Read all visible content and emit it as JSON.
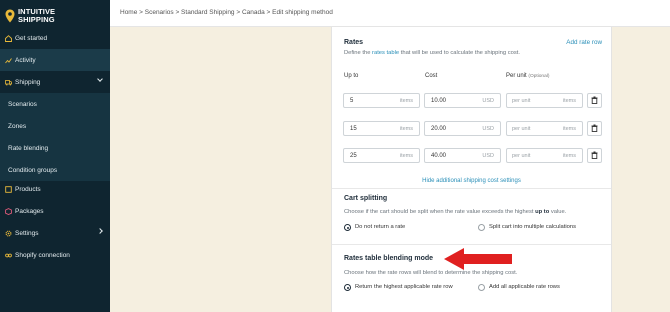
{
  "brand": {
    "line1": "INTUITIVE",
    "line2": "SHIPPING"
  },
  "sidebar": {
    "items": [
      {
        "label": "Get started",
        "icon": "home-icon"
      },
      {
        "label": "Activity",
        "icon": "chart-icon"
      },
      {
        "label": "Shipping",
        "icon": "truck-icon"
      },
      {
        "label": "Scenarios"
      },
      {
        "label": "Zones"
      },
      {
        "label": "Rate blending"
      },
      {
        "label": "Condition groups"
      },
      {
        "label": "Products",
        "icon": "products-icon"
      },
      {
        "label": "Packages",
        "icon": "package-icon"
      },
      {
        "label": "Settings",
        "icon": "gear-icon"
      },
      {
        "label": "Shopify connection",
        "icon": "connection-icon"
      }
    ],
    "accent": "#e8b93a"
  },
  "breadcrumb": "Home > Scenarios > Standard Shipping > Canada > Edit shipping method",
  "rates": {
    "title": "Rates",
    "add_label": "Add rate row",
    "desc_prefix": "Define the ",
    "desc_link": "rates table",
    "desc_suffix": " that will be used to calculate the shipping cost.",
    "col_up_to": "Up to",
    "col_cost": "Cost",
    "col_per_unit": "Per unit",
    "col_optional": "(Optional)",
    "rows": [
      {
        "up_to": "5",
        "up_unit": "items",
        "cost": "10.00",
        "currency": "USD",
        "per_unit_placeholder": "per unit",
        "per_unit_unit": "items"
      },
      {
        "up_to": "15",
        "up_unit": "items",
        "cost": "20.00",
        "currency": "USD",
        "per_unit_placeholder": "per unit",
        "per_unit_unit": "items"
      },
      {
        "up_to": "25",
        "up_unit": "items",
        "cost": "40.00",
        "currency": "USD",
        "per_unit_placeholder": "per unit",
        "per_unit_unit": "items"
      }
    ],
    "hide_additional": "Hide additional shipping cost settings"
  },
  "cart_splitting": {
    "title": "Cart splitting",
    "desc_prefix": "Choose if the cart should be split when the rate value exceeds the highest ",
    "desc_bold": "up to",
    "desc_suffix": " value.",
    "option_no": "Do not return a rate",
    "option_split": "Split cart into multiple calculations"
  },
  "blending": {
    "title": "Rates table blending mode",
    "desc": "Choose how the rate rows will blend to determine the shipping cost.",
    "option_highest": "Return the highest applicable rate row",
    "option_all": "Add all applicable rate rows"
  },
  "colors": {
    "arrow": "#e02020",
    "link": "#2a8fb8"
  }
}
